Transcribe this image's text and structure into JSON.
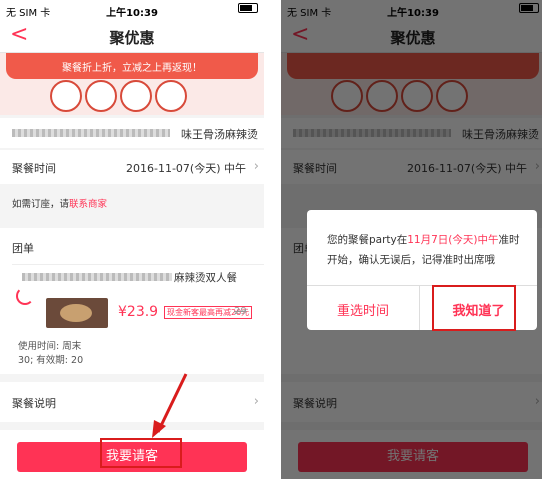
{
  "status": {
    "carrier": "无 SIM 卡",
    "time": "上午10:39"
  },
  "nav": {
    "back": "<",
    "title": "聚优惠"
  },
  "banner": {
    "text": "聚餐折上折，立减之上再返现！"
  },
  "restaurant": {
    "name_suffix": "味王骨汤麻辣烫"
  },
  "dining_time": {
    "label": "聚餐时间",
    "value": "2016-11-07(今天) 中午"
  },
  "booking_hint": {
    "prefix": "如需订座，请",
    "link": "联系商家"
  },
  "group": {
    "label": "团单",
    "deal_suffix": "麻辣烫双人餐",
    "price": "¥23.9",
    "tag": "现金新客最高再减20元",
    "original": "29",
    "usage_prefix": "使用时间: 周末",
    "validity_prefix": "30; 有效期: 20"
  },
  "description": {
    "label": "聚餐说明"
  },
  "invite_button": {
    "label": "我要请客"
  },
  "dialog": {
    "msg_prefix": "您的聚餐party在",
    "msg_date": "11月7日(今天)中午",
    "msg_suffix": "准时开始，确认无误后，记得准时出席哦",
    "reselect": "重选时间",
    "ok": "我知道了"
  },
  "colors": {
    "accent": "#ff3355",
    "highlight_box": "#d91c1c"
  }
}
